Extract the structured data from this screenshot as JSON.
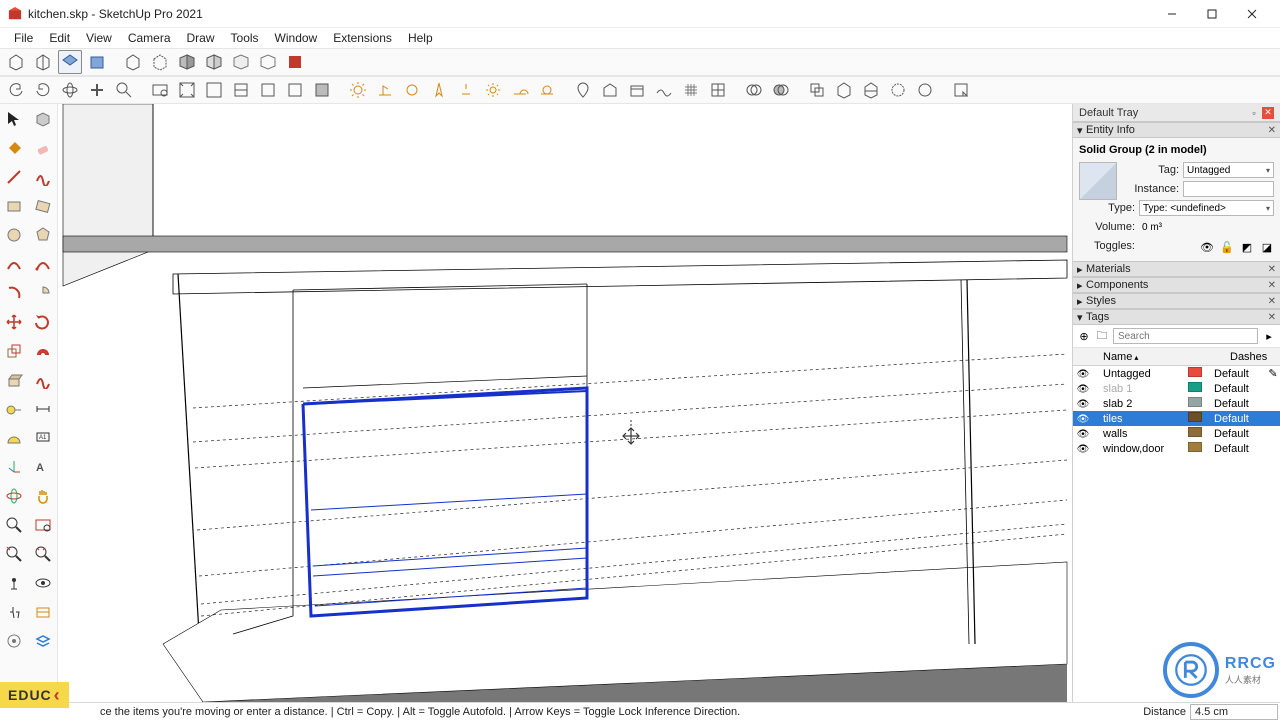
{
  "window": {
    "title": "kitchen.skp - SketchUp Pro 2021"
  },
  "menu": [
    "File",
    "Edit",
    "View",
    "Camera",
    "Draw",
    "Tools",
    "Window",
    "Extensions",
    "Help"
  ],
  "tray": {
    "title": "Default Tray",
    "entityInfo": {
      "panel": "Entity Info",
      "selection": "Solid Group (2 in model)",
      "tag_label": "Tag:",
      "tag": "Untagged",
      "instance_label": "Instance:",
      "instance": "",
      "type_label": "Type:",
      "type": "Type: <undefined>",
      "volume_label": "Volume:",
      "volume": "0 m³",
      "toggles_label": "Toggles:"
    },
    "panels": {
      "materials": "Materials",
      "components": "Components",
      "styles": "Styles",
      "tags": "Tags"
    },
    "tags": {
      "search_placeholder": "Search",
      "col_name": "Name",
      "col_dashes": "Dashes",
      "rows": [
        {
          "name": "Untagged",
          "color": "#e74c3c",
          "dashes": "Default",
          "visible": true,
          "selected": false,
          "editable": true,
          "dim": false
        },
        {
          "name": "slab 1",
          "color": "#16a085",
          "dashes": "Default",
          "visible": true,
          "selected": false,
          "editable": false,
          "dim": true
        },
        {
          "name": "slab 2",
          "color": "#95a5a6",
          "dashes": "Default",
          "visible": true,
          "selected": false,
          "editable": false,
          "dim": false
        },
        {
          "name": "tiles",
          "color": "#6b4f2a",
          "dashes": "Default",
          "visible": true,
          "selected": true,
          "editable": false,
          "dim": false
        },
        {
          "name": "walls",
          "color": "#8d6e3a",
          "dashes": "Default",
          "visible": true,
          "selected": false,
          "editable": false,
          "dim": false
        },
        {
          "name": "window,door",
          "color": "#a07d3b",
          "dashes": "Default",
          "visible": true,
          "selected": false,
          "editable": false,
          "dim": false
        }
      ]
    }
  },
  "status": {
    "msg": "ce the items you're moving or enter a distance. | Ctrl = Copy. | Alt = Toggle Autofold. | Arrow Keys = Toggle Lock Inference Direction.",
    "distance_label": "Distance",
    "distance_value": "4.5 cm"
  },
  "watermark": {
    "left": "EDUC",
    "right": "RRCG",
    "right_sub": "人人素材"
  }
}
